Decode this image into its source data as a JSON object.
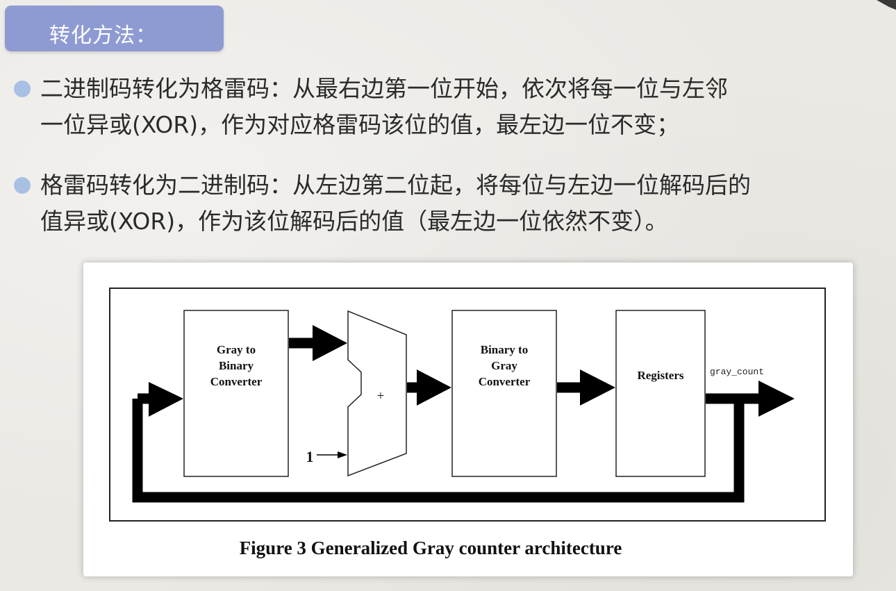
{
  "slide": {
    "title": "转化方法：",
    "bullets": [
      {
        "lines": [
          "二进制码转化为格雷码：从最右边第一位开始，依次将每一位与左邻",
          "一位异或(XOR)，作为对应格雷码该位的值，最左边一位不变；"
        ]
      },
      {
        "lines": [
          "格雷码转化为二进制码：从左边第二位起，将每位与左边一位解码后的",
          "值异或(XOR)，作为该位解码后的值（最左边一位依然不变）。"
        ]
      }
    ]
  },
  "figure": {
    "blocks": [
      {
        "name": "gray-to-binary-converter-block",
        "lines": [
          "Gray to",
          "Binary",
          "Converter"
        ]
      },
      {
        "name": "binary-to-gray-converter-block",
        "lines": [
          "Binary to",
          "Gray",
          "Converter"
        ]
      },
      {
        "name": "registers-block",
        "lines": [
          "Registers"
        ]
      }
    ],
    "adder_symbol": "+",
    "constant_input": "1",
    "output_label": "gray_count",
    "caption": "Figure 3 Generalized Gray counter architecture"
  },
  "colors": {
    "title_bg": "#8e9bd3",
    "bullet_dot": "#a7c0e4",
    "background": "#ebe9e4"
  }
}
